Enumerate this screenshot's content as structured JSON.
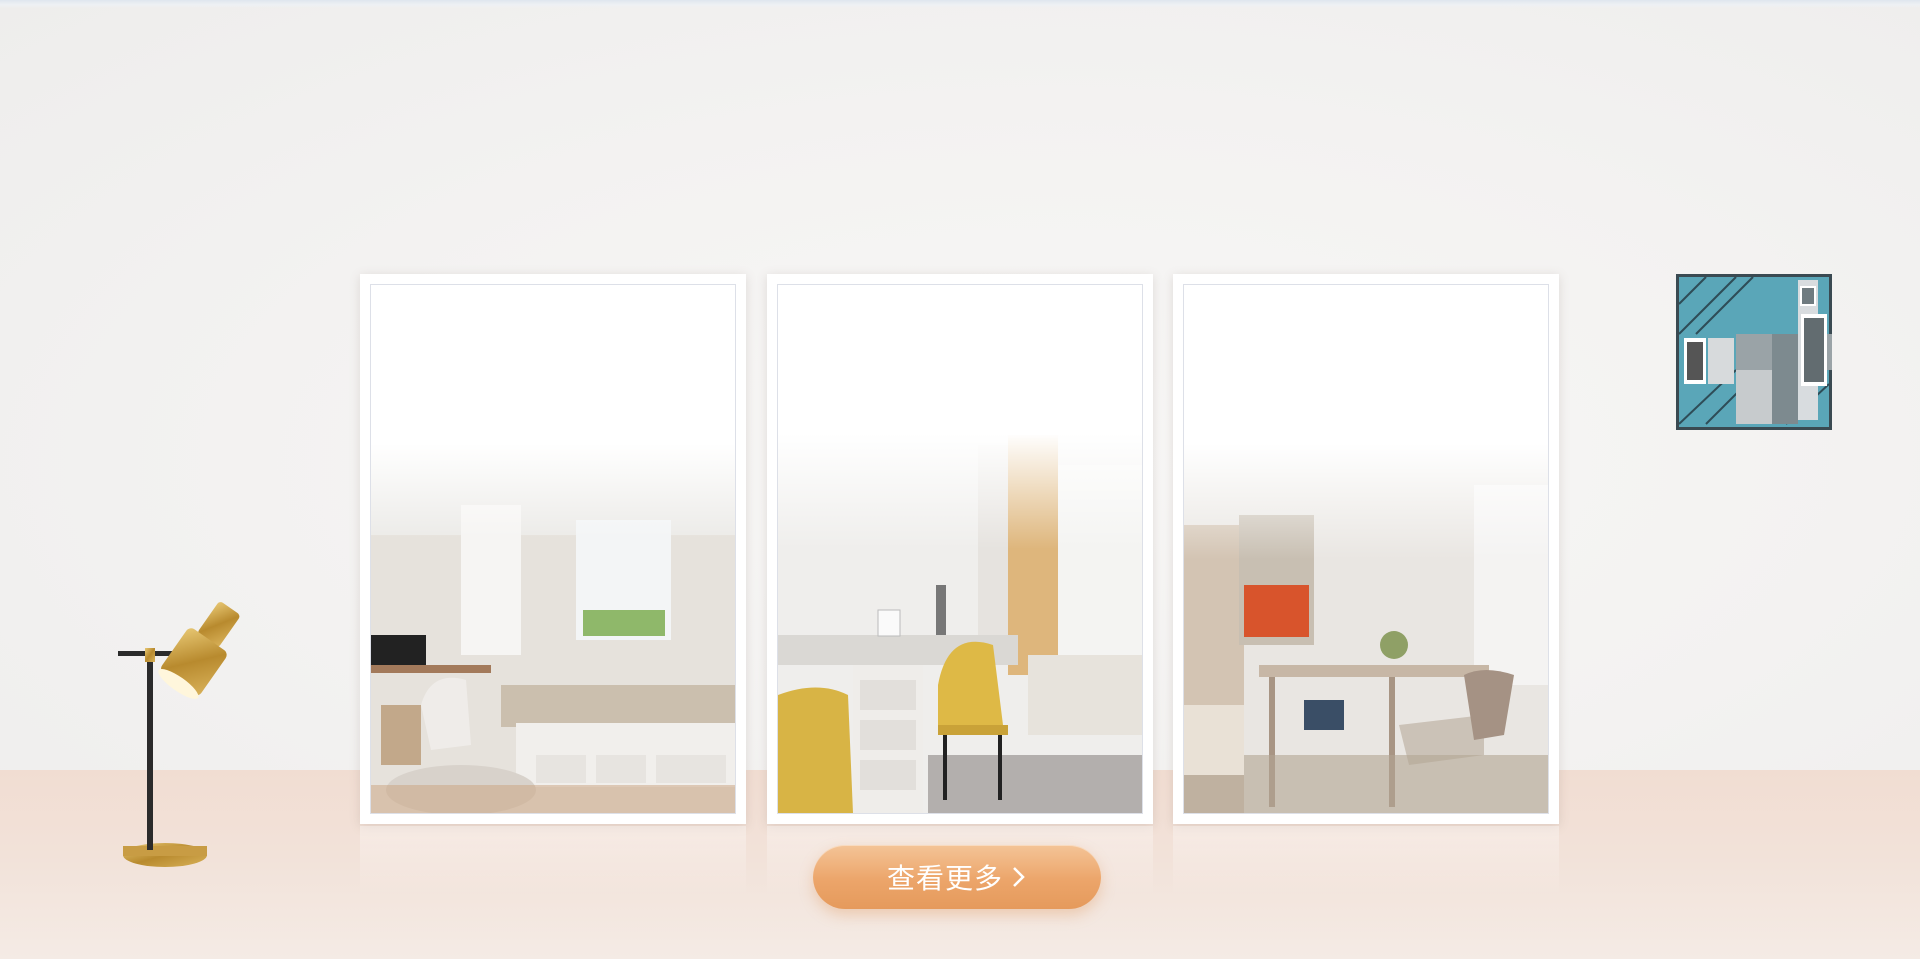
{
  "gallery": {
    "cta_label": "查看更多",
    "cta_icon": "chevron-right-icon",
    "frames": [
      {
        "scene": "bedroom-with-window-seat"
      },
      {
        "scene": "study-desk-with-yellow-chair"
      },
      {
        "scene": "tea-room-with-dining-table"
      }
    ]
  },
  "colors": {
    "accent": "#eca56a",
    "lamp_gold": "#c9a24a",
    "art_teal": "#4e9fb0"
  }
}
